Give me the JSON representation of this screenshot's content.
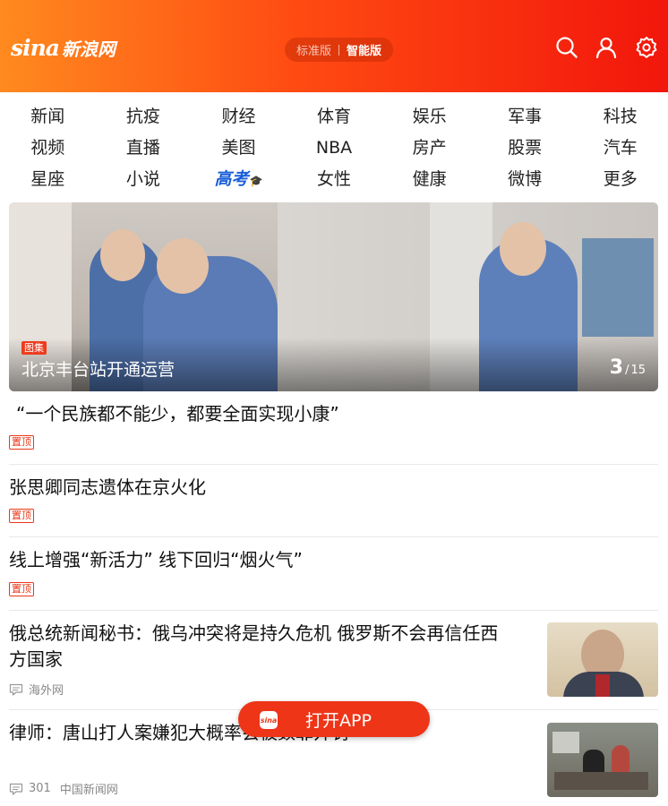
{
  "header": {
    "logo_text": "sina",
    "logo_cn": "新浪网",
    "mode_standard": "标准版",
    "mode_smart": "智能版",
    "icons": [
      "search-icon",
      "user-icon",
      "settings-icon"
    ],
    "brand_color": "#f2160c"
  },
  "nav": {
    "rows": [
      [
        "新闻",
        "抗疫",
        "财经",
        "体育",
        "娱乐",
        "军事",
        "科技"
      ],
      [
        "视频",
        "直播",
        "美图",
        "NBA",
        "房产",
        "股票",
        "汽车"
      ],
      [
        "星座",
        "小说",
        "高考",
        "女性",
        "健康",
        "微博",
        "更多"
      ]
    ]
  },
  "feature": {
    "tag": "图集",
    "title": "北京丰台站开通运营",
    "current": "3",
    "total": "15"
  },
  "news": [
    {
      "title": "“一个民族都不能少，都要全面实现小康”",
      "pin": "置顶"
    },
    {
      "title": "张思卿同志遗体在京火化",
      "pin": "置顶"
    },
    {
      "title": "线上增强“新活力” 线下回归“烟火气”",
      "pin": "置顶"
    },
    {
      "title_line1": "俄总统新闻秘书：俄乌冲突将是持久危机 俄罗斯不会再信任西",
      "title_line2": "方国家",
      "source": "海外网"
    },
    {
      "title": "律师：唐山打人案嫌犯大概率会被数罪并罚",
      "comments": "301",
      "source": "中国新闻网"
    }
  ],
  "app_button": {
    "label": "打开APP",
    "icon_text": "sina"
  }
}
